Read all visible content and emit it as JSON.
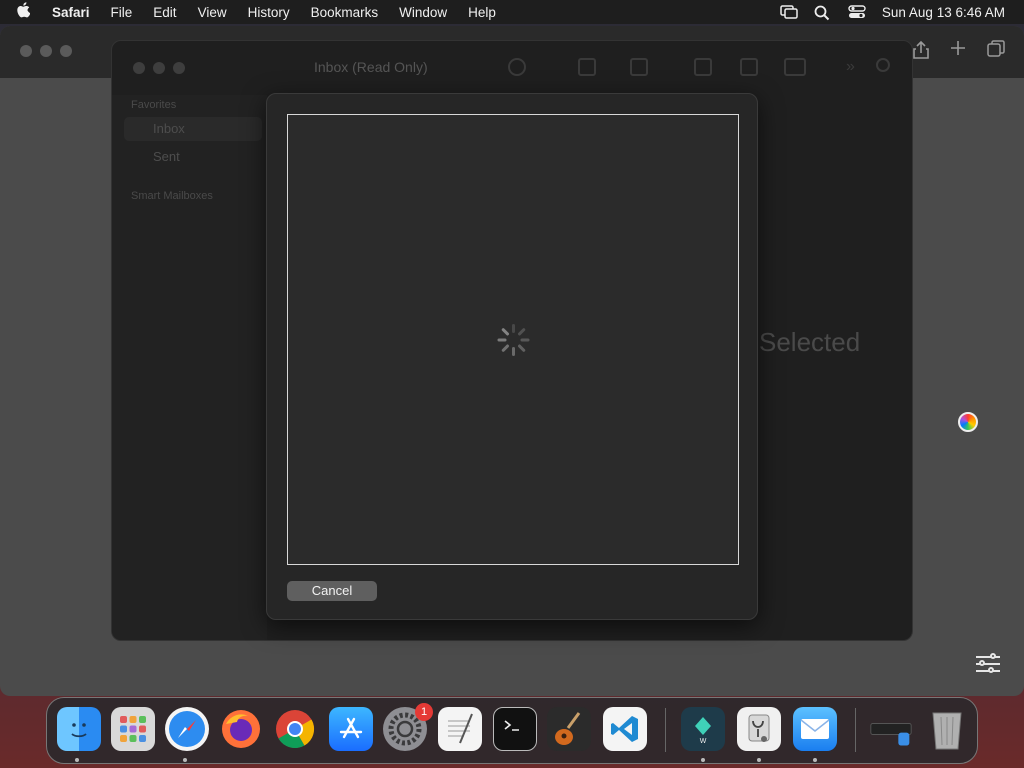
{
  "menubar": {
    "app_name": "Safari",
    "menus": [
      "File",
      "Edit",
      "View",
      "History",
      "Bookmarks",
      "Window",
      "Help"
    ],
    "clock": "Sun Aug 13  6:46 AM",
    "status_icons": [
      "screen-mirroring-icon",
      "search-icon",
      "control-center-icon"
    ]
  },
  "mail": {
    "title": "Inbox (Read Only)",
    "sidebar": {
      "favorites_header": "Favorites",
      "items": [
        "Inbox",
        "Sent"
      ],
      "smart_header": "Smart Mailboxes"
    },
    "empty_state": "Selected"
  },
  "sheet": {
    "cancel_label": "Cancel"
  },
  "dock": {
    "apps": [
      {
        "name": "finder",
        "icon": "finder-icon",
        "running": true
      },
      {
        "name": "launchpad",
        "icon": "launchpad-icon",
        "running": false
      },
      {
        "name": "safari",
        "icon": "safari-icon",
        "running": true
      },
      {
        "name": "firefox",
        "icon": "firefox-icon",
        "running": false
      },
      {
        "name": "chrome",
        "icon": "chrome-icon",
        "running": false
      },
      {
        "name": "app-store",
        "icon": "app-store-icon",
        "running": false
      },
      {
        "name": "system-settings",
        "icon": "gear-icon",
        "running": false,
        "badge": "1"
      },
      {
        "name": "textedit",
        "icon": "textedit-icon",
        "running": false
      },
      {
        "name": "terminal",
        "icon": "terminal-icon",
        "running": false
      },
      {
        "name": "garageband",
        "icon": "guitar-icon",
        "running": false
      },
      {
        "name": "vscode",
        "icon": "vscode-icon",
        "running": false
      },
      {
        "name": "filmora",
        "icon": "filmora-icon",
        "running": true
      },
      {
        "name": "disk-utility",
        "icon": "stethoscope-icon",
        "running": true
      },
      {
        "name": "mail",
        "icon": "mail-icon",
        "running": true
      }
    ],
    "badge_value": "1"
  },
  "colors": {
    "menubar_bg": "#1e1e1e",
    "window_bg": "#1f1f1f",
    "sheet_bg": "#262626",
    "cancel_bg": "#5f5f5f",
    "badge": "#e53935"
  }
}
